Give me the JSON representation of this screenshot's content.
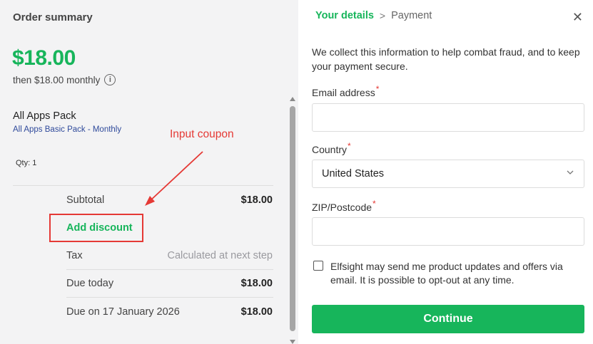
{
  "summary": {
    "title": "Order summary",
    "price": "$18.00",
    "then_text": "then $18.00 monthly",
    "info_icon": "i",
    "product": {
      "name": "All Apps Pack",
      "subtitle": "All Apps Basic Pack - Monthly",
      "qty": "Qty: 1"
    },
    "rows": {
      "subtotal_label": "Subtotal",
      "subtotal_value": "$18.00",
      "add_discount": "Add discount",
      "tax_label": "Tax",
      "tax_value": "Calculated at next step",
      "due_today_label": "Due today",
      "due_today_value": "$18.00",
      "due_on_label": "Due on 17 January 2026",
      "due_on_value": "$18.00"
    },
    "annotation": "Input coupon"
  },
  "checkout": {
    "breadcrumb": {
      "active": "Your details",
      "separator": ">",
      "next": "Payment"
    },
    "close": "✕",
    "intro": "We collect this information to help combat fraud, and to keep your payment secure.",
    "email_label": "Email address",
    "country_label": "Country",
    "country_value": "United States",
    "zip_label": "ZIP/Postcode",
    "required_mark": "*",
    "consent_text": "Elfsight may send me product updates and offers via email. It is possible to opt-out at any time.",
    "continue_label": "Continue"
  },
  "colors": {
    "accent": "#17b55b",
    "annotation": "#e53935",
    "panel_bg": "#f3f3f4"
  }
}
